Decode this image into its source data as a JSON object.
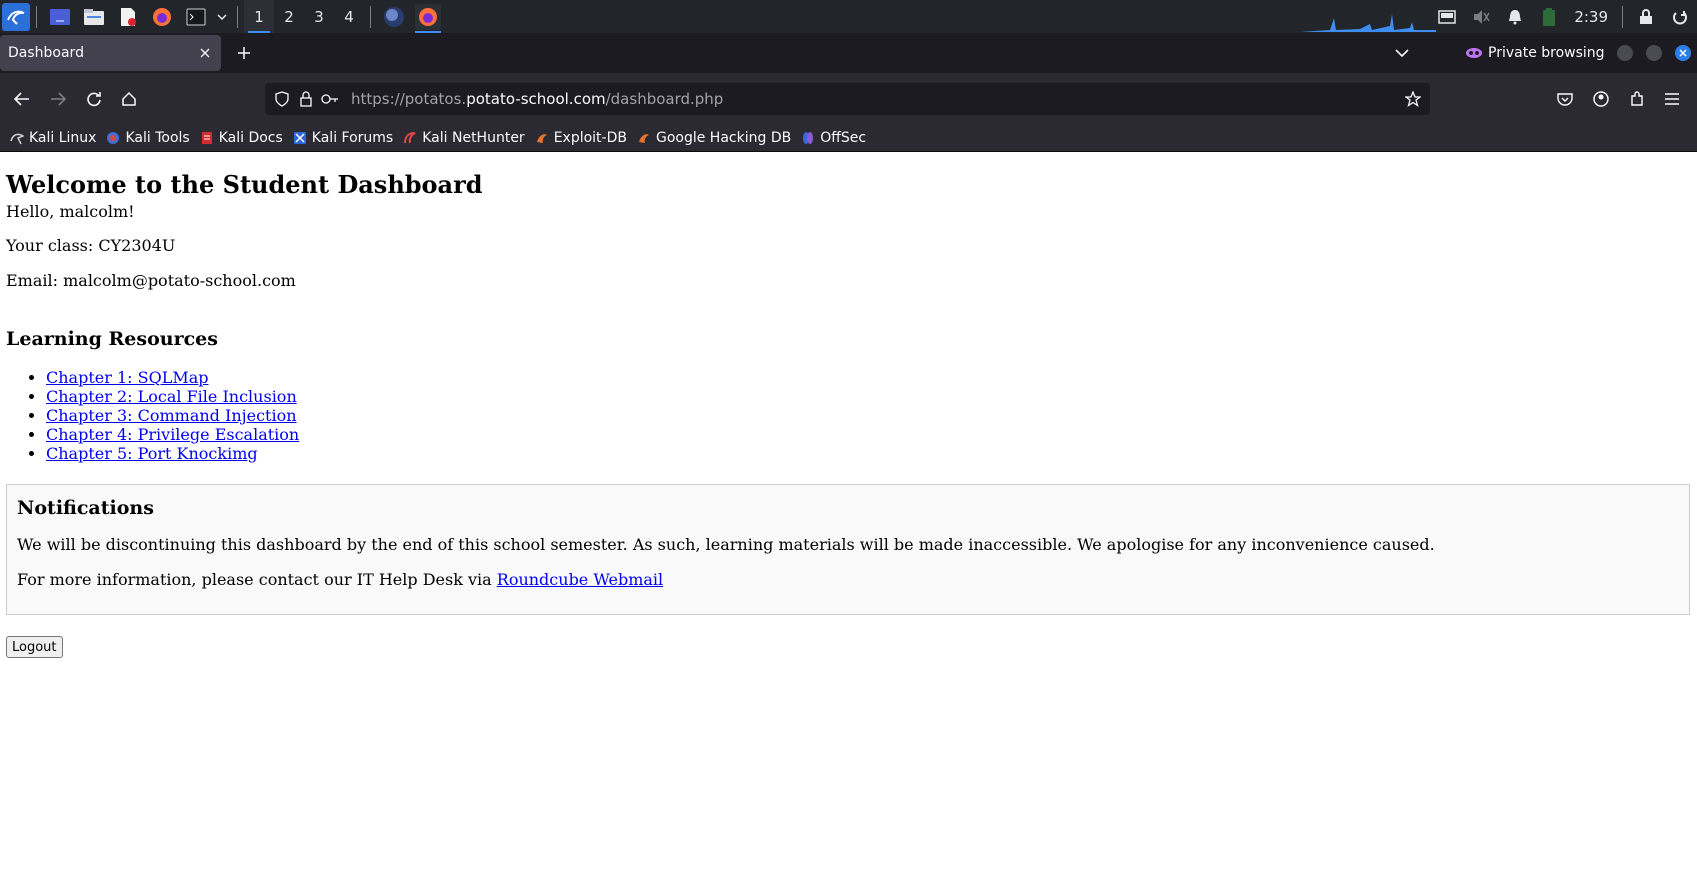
{
  "taskbar": {
    "workspaces": [
      "1",
      "2",
      "3",
      "4"
    ],
    "active_workspace": "1",
    "clock": "2:39",
    "accent_color": "#3d8ef0"
  },
  "browser": {
    "tab": {
      "title": "Dashboard"
    },
    "private_label": "Private browsing",
    "url": {
      "prefix": "https://potatos.",
      "host": "potato-school.com",
      "path": "/dashboard.php"
    },
    "bookmarks": [
      {
        "label": "Kali Linux",
        "icon": "kali-dragon-icon"
      },
      {
        "label": "Kali Tools",
        "icon": "kali-tools-icon"
      },
      {
        "label": "Kali Docs",
        "icon": "kali-docs-icon"
      },
      {
        "label": "Kali Forums",
        "icon": "kali-forums-icon"
      },
      {
        "label": "Kali NetHunter",
        "icon": "nethunter-icon"
      },
      {
        "label": "Exploit-DB",
        "icon": "exploit-db-icon"
      },
      {
        "label": "Google Hacking DB",
        "icon": "ghdb-icon"
      },
      {
        "label": "OffSec",
        "icon": "offsec-icon"
      }
    ]
  },
  "page": {
    "heading": "Welcome to the Student Dashboard",
    "greeting": "Hello, malcolm!",
    "class_line": "Your class: CY2304U",
    "email_line": "Email: malcolm@potato-school.com",
    "resources_heading": "Learning Resources",
    "chapters": [
      "Chapter 1: SQLMap",
      "Chapter 2: Local File Inclusion",
      "Chapter 3: Command Injection",
      "Chapter 4: Privilege Escalation",
      "Chapter 5: Port Knockimg"
    ],
    "notifications": {
      "heading": "Notifications",
      "message": "We will be discontinuing this dashboard by the end of this school semester. As such, learning materials will be made inaccessible. We apologise for any inconvenience caused.",
      "contact_prefix": "For more information, please contact our IT Help Desk via ",
      "contact_link": "Roundcube Webmail"
    },
    "logout_label": "Logout"
  }
}
